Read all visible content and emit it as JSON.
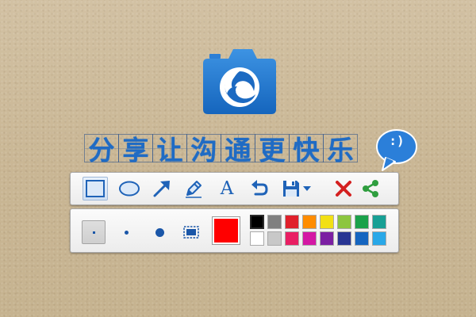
{
  "slogan": {
    "chars": [
      "分",
      "享",
      "让",
      "沟",
      "通",
      "更",
      "快",
      "乐"
    ],
    "bubble_text": ":)"
  },
  "colors": {
    "accent": "#1f6bc4",
    "current_color": "#ff0000",
    "close_red": "#d42020",
    "share_green": "#2f9e3f"
  },
  "toolbar": {
    "tools": [
      {
        "id": "rectangle",
        "icon": "rectangle-icon",
        "active": true
      },
      {
        "id": "ellipse",
        "icon": "ellipse-icon",
        "active": false
      },
      {
        "id": "arrow",
        "icon": "arrow-icon",
        "active": false
      },
      {
        "id": "pencil",
        "icon": "pencil-icon",
        "active": false
      },
      {
        "id": "text",
        "icon": "text-icon",
        "label": "A",
        "active": false
      },
      {
        "id": "undo",
        "icon": "undo-icon",
        "active": false
      },
      {
        "id": "save",
        "icon": "save-icon",
        "active": false
      },
      {
        "id": "save-dropdown",
        "icon": "caret-down-icon",
        "active": false
      },
      {
        "id": "close",
        "icon": "close-icon",
        "active": false
      },
      {
        "id": "share",
        "icon": "share-icon",
        "active": false
      }
    ]
  },
  "options": {
    "sizes": [
      {
        "id": "size-small",
        "active": true
      },
      {
        "id": "size-medium",
        "active": false
      },
      {
        "id": "size-large",
        "active": false
      },
      {
        "id": "mosaic",
        "icon": "mosaic-icon",
        "active": false
      }
    ],
    "palette": [
      "#000000",
      "#808080",
      "#e0202b",
      "#ff8c00",
      "#f2e014",
      "#8cc63f",
      "#1aa14a",
      "#18a095",
      "#ffffff",
      "#c8c8c8",
      "#e91e63",
      "#d418a4",
      "#7b1fa2",
      "#283593",
      "#1565c0",
      "#29a8e8"
    ],
    "selected_swatch": 0
  }
}
